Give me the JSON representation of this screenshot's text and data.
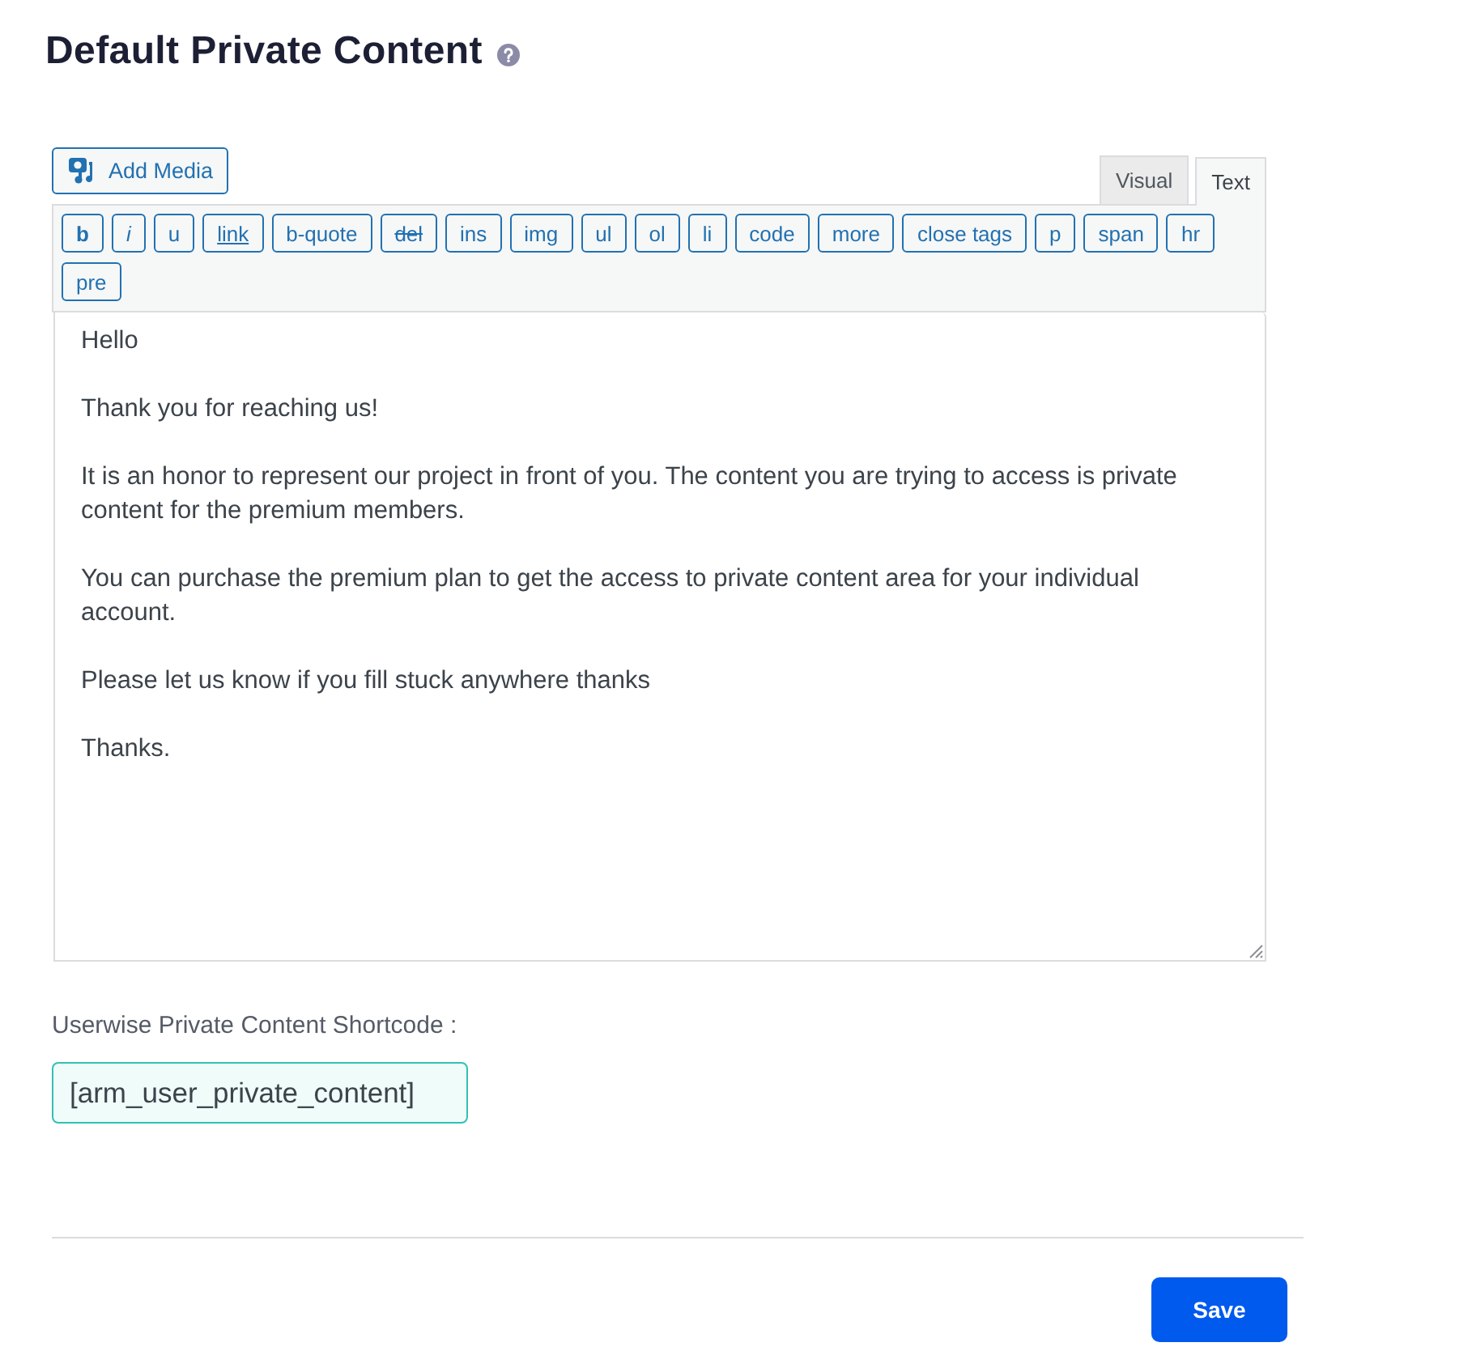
{
  "heading": {
    "title": "Default Private Content"
  },
  "editor": {
    "add_media": "Add Media",
    "tabs": [
      {
        "label": "Visual",
        "selected": false
      },
      {
        "label": "Text",
        "selected": true
      }
    ],
    "quicktags": [
      {
        "label": "b",
        "kind": "bold"
      },
      {
        "label": "i",
        "kind": "italic"
      },
      {
        "label": "u",
        "kind": "plain"
      },
      {
        "label": "link",
        "kind": "underline"
      },
      {
        "label": "b-quote",
        "kind": "plain"
      },
      {
        "label": "del",
        "kind": "strike"
      },
      {
        "label": "ins",
        "kind": "plain"
      },
      {
        "label": "img",
        "kind": "plain"
      },
      {
        "label": "ul",
        "kind": "plain"
      },
      {
        "label": "ol",
        "kind": "plain"
      },
      {
        "label": "li",
        "kind": "plain"
      },
      {
        "label": "code",
        "kind": "plain"
      },
      {
        "label": "more",
        "kind": "plain"
      },
      {
        "label": "close tags",
        "kind": "plain"
      },
      {
        "label": "p",
        "kind": "plain"
      },
      {
        "label": "span",
        "kind": "plain"
      },
      {
        "label": "hr",
        "kind": "plain"
      },
      {
        "label": "pre",
        "kind": "plain"
      }
    ],
    "content": "Hello\n\nThank you for reaching us!\n\nIt is an honor to represent our project in front of you. The content you are trying to access is private content for the premium members.\n\nYou can purchase the premium plan to get the access to private content area for your individual account.\n\nPlease let us know if you fill stuck anywhere thanks\n\nThanks."
  },
  "shortcode": {
    "label": "Userwise Private Content Shortcode :",
    "value": "[arm_user_private_content]"
  },
  "footer": {
    "save": "Save"
  }
}
